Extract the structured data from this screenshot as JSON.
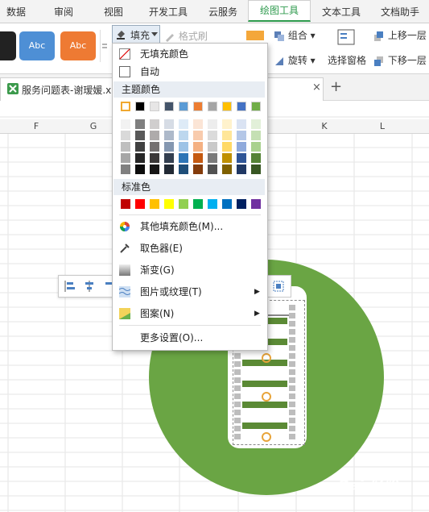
{
  "ribbon": {
    "tabs": [
      "数据",
      "审阅",
      "视图",
      "开发工具",
      "云服务",
      "绘图工具",
      "文本工具",
      "文档助手"
    ],
    "active_tab": "绘图工具",
    "style_buttons": [
      "Abc",
      "Abc"
    ],
    "fill_label": "填充",
    "format_painter_label": "格式刷",
    "group_label": "组合",
    "rotate_label": "旋转",
    "selection_pane_label": "选择窗格",
    "bring_forward_label": "上移一层",
    "send_backward_label": "下移一层"
  },
  "doc_tab": {
    "title": "服务问题表-谢瑷媛.xl",
    "close": "×",
    "add": "+"
  },
  "columns": [
    "F",
    "G",
    "",
    "",
    "J",
    "K",
    "L"
  ],
  "fill_menu": {
    "no_fill": "无填充颜色",
    "auto": "自动",
    "theme_colors_title": "主题颜色",
    "standard_colors_title": "标准色",
    "more_colors": "其他填充颜色(M)...",
    "eyedropper": "取色器(E)",
    "gradient": "渐变(G)",
    "picture_texture": "图片或纹理(T)",
    "pattern": "图案(N)",
    "more_settings": "更多设置(O)...",
    "theme_top_row": [
      "#ffffff",
      "#000000",
      "#e7e6e6",
      "#44546a",
      "#5b9bd5",
      "#ed7d31",
      "#a5a5a5",
      "#ffc000",
      "#4472c4",
      "#70ad47"
    ],
    "theme_shades": [
      [
        "#f2f2f2",
        "#7f7f7f",
        "#d0cece",
        "#d6dce5",
        "#deebf7",
        "#fbe5d6",
        "#ededed",
        "#fff2cc",
        "#dae3f3",
        "#e2f0d9"
      ],
      [
        "#d9d9d9",
        "#595959",
        "#aeabab",
        "#adb9ca",
        "#bdd7ee",
        "#f8cbad",
        "#dbdbdb",
        "#ffe699",
        "#b4c7e7",
        "#c5e0b4"
      ],
      [
        "#bfbfbf",
        "#404040",
        "#757171",
        "#8497b0",
        "#9dc3e6",
        "#f4b183",
        "#c9c9c9",
        "#ffd966",
        "#8faadc",
        "#a9d18e"
      ],
      [
        "#a6a6a6",
        "#262626",
        "#3b3838",
        "#333f50",
        "#2e75b6",
        "#c55a11",
        "#7b7b7b",
        "#bf9000",
        "#2f5597",
        "#548235"
      ],
      [
        "#808080",
        "#0d0d0d",
        "#171616",
        "#222a35",
        "#1f4e79",
        "#843c0c",
        "#525252",
        "#7f6000",
        "#203864",
        "#385723"
      ]
    ],
    "standard_colors": [
      "#c00000",
      "#ff0000",
      "#ffc000",
      "#ffff00",
      "#92d050",
      "#00b050",
      "#00b0f0",
      "#0070c0",
      "#002060",
      "#7030a0"
    ]
  },
  "colors": {
    "accent": "#2e9a4d",
    "circle": "#6aa544",
    "style_blue": "#4e8fd5",
    "style_orange": "#ee7a33"
  },
  "watermark": "Bai 经验"
}
